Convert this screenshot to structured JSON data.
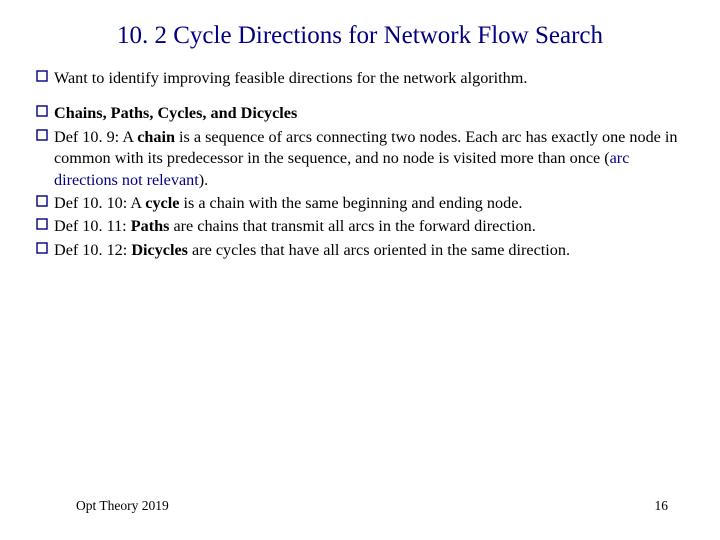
{
  "title": "10. 2 Cycle Directions for Network Flow Search",
  "bullets": {
    "b1": "Want to identify improving feasible directions for the network algorithm.",
    "b2": "<b>Chains, Paths, Cycles, and Dicycles</b>",
    "b3": "Def 10. 9: A <b>chain</b> is a sequence of arcs connecting two nodes. Each arc has exactly one node in common with its predecessor in the sequence, and no node is visited more than once (<span class=\"highlight\">arc directions not relevant</span>).",
    "b4": "Def 10. 10: A <b>cycle</b> is a chain with the same beginning and ending node.",
    "b5": "Def 10. 11: <b>Paths</b> are chains that transmit all arcs in the forward direction.",
    "b6": "Def 10. 12: <b>Dicycles</b> are cycles that have all arcs oriented in the same direction."
  },
  "footer": {
    "left": "Opt Theory 2019",
    "right": "16"
  }
}
